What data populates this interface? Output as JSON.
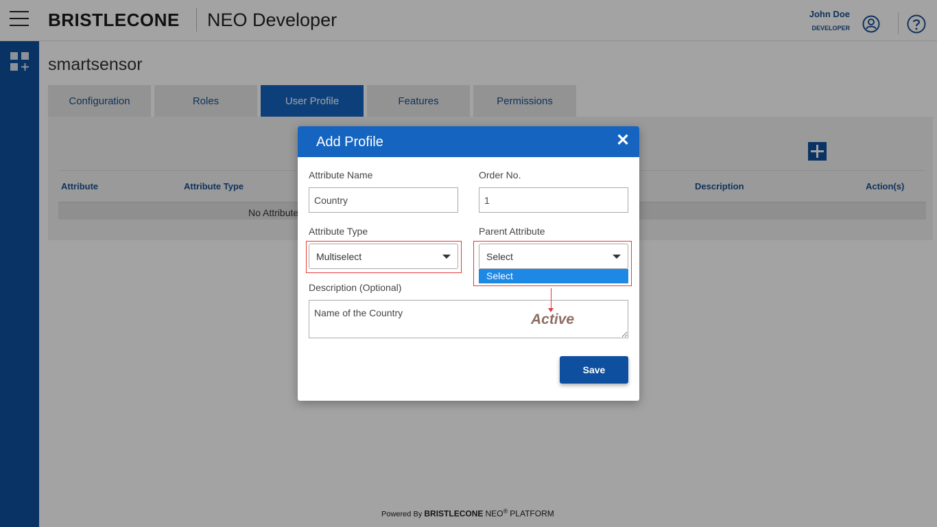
{
  "header": {
    "logo_text": "BRISTLECONE",
    "app_title": "NEO Developer",
    "user_name": "John Doe",
    "user_role": "DEVELOPER"
  },
  "page": {
    "title": "smartsensor"
  },
  "tabs": [
    {
      "label": "Configuration",
      "active": false
    },
    {
      "label": "Roles",
      "active": false
    },
    {
      "label": "User Profile",
      "active": true
    },
    {
      "label": "Features",
      "active": false
    },
    {
      "label": "Permissions",
      "active": false
    }
  ],
  "table": {
    "headers": [
      "Attribute",
      "Attribute Type",
      "Description",
      "Action(s)"
    ],
    "empty_message": "No Attribute"
  },
  "modal": {
    "title": "Add Profile",
    "attribute_name_label": "Attribute Name",
    "attribute_name_value": "Country",
    "order_no_label": "Order No.",
    "order_no_value": "1",
    "attribute_type_label": "Attribute Type",
    "attribute_type_value": "Multiselect",
    "parent_attribute_label": "Parent Attribute",
    "parent_attribute_value": "Select",
    "parent_attribute_option": "Select",
    "description_label": "Description (Optional)",
    "description_value": "Name of the Country",
    "annotation": "Active",
    "save_label": "Save"
  },
  "footer": {
    "powered_by": "Powered By",
    "brand": "BRISTLECONE",
    "neo": "NEO",
    "registered": "®",
    "platform": "PLATFORM"
  },
  "colors": {
    "primary": "#1565c0",
    "sidebar": "#0f4f9f",
    "annotation_red": "#e53935",
    "dropdown_highlight": "#1e88e5"
  }
}
